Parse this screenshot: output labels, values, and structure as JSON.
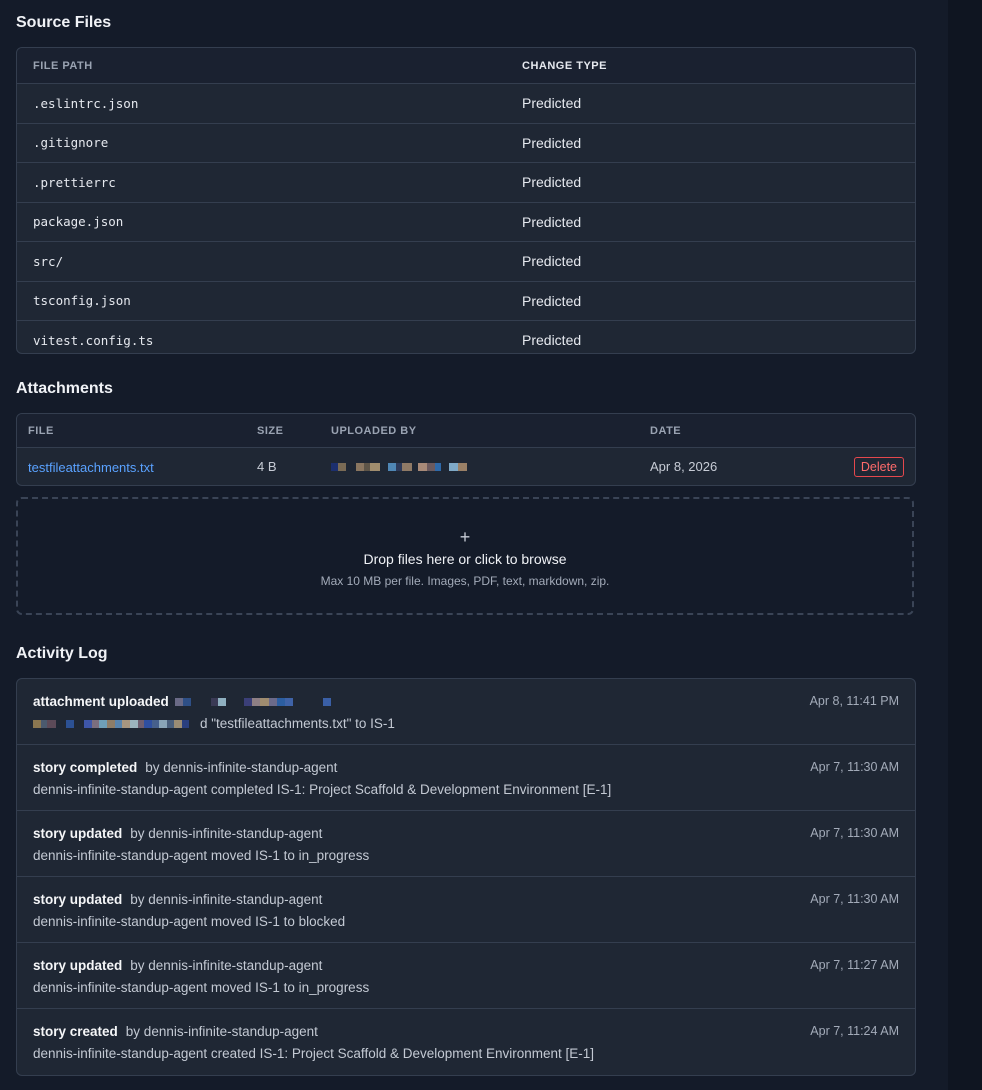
{
  "source_files": {
    "title": "Source Files",
    "columns": [
      "FILE PATH",
      "CHANGE TYPE"
    ],
    "rows": [
      {
        "path": ".eslintrc.json",
        "type": "Predicted"
      },
      {
        "path": ".gitignore",
        "type": "Predicted"
      },
      {
        "path": ".prettierrc",
        "type": "Predicted"
      },
      {
        "path": "package.json",
        "type": "Predicted"
      },
      {
        "path": "src/",
        "type": "Predicted"
      },
      {
        "path": "tsconfig.json",
        "type": "Predicted"
      },
      {
        "path": "vitest.config.ts",
        "type": "Predicted"
      }
    ]
  },
  "attachments": {
    "title": "Attachments",
    "columns": [
      "FILE",
      "SIZE",
      "UPLOADED BY",
      "DATE"
    ],
    "rows": [
      {
        "file": "testfileattachments.txt",
        "size": "4 B",
        "date": "Apr 8, 2026",
        "delete_label": "Delete"
      }
    ],
    "dropzone": {
      "icon": "+",
      "main": "Drop files here or click to browse",
      "sub": "Max 10 MB per file. Images, PDF, text, markdown, zip."
    }
  },
  "activity": {
    "title": "Activity Log",
    "entries": [
      {
        "title": "attachment uploaded",
        "by": "",
        "description": "d \"testfileattachments.txt\" to IS-1",
        "time": "Apr 8, 11:41 PM"
      },
      {
        "title": "story completed",
        "by": "by dennis-infinite-standup-agent",
        "description": "dennis-infinite-standup-agent completed IS-1: Project Scaffold & Development Environment [E-1]",
        "time": "Apr 7, 11:30 AM"
      },
      {
        "title": "story updated",
        "by": "by dennis-infinite-standup-agent",
        "description": "dennis-infinite-standup-agent moved IS-1 to in_progress",
        "time": "Apr 7, 11:30 AM"
      },
      {
        "title": "story updated",
        "by": "by dennis-infinite-standup-agent",
        "description": "dennis-infinite-standup-agent moved IS-1 to blocked",
        "time": "Apr 7, 11:30 AM"
      },
      {
        "title": "story updated",
        "by": "by dennis-infinite-standup-agent",
        "description": "dennis-infinite-standup-agent moved IS-1 to in_progress",
        "time": "Apr 7, 11:27 AM"
      },
      {
        "title": "story created",
        "by": "by dennis-infinite-standup-agent",
        "description": "dennis-infinite-standup-agent created IS-1: Project Scaffold & Development Environment [E-1]",
        "time": "Apr 7, 11:24 AM"
      }
    ]
  },
  "colors": {
    "background": "#141b29",
    "card": "#1f2734",
    "link": "#5aa2ff",
    "danger": "#e5484d"
  }
}
